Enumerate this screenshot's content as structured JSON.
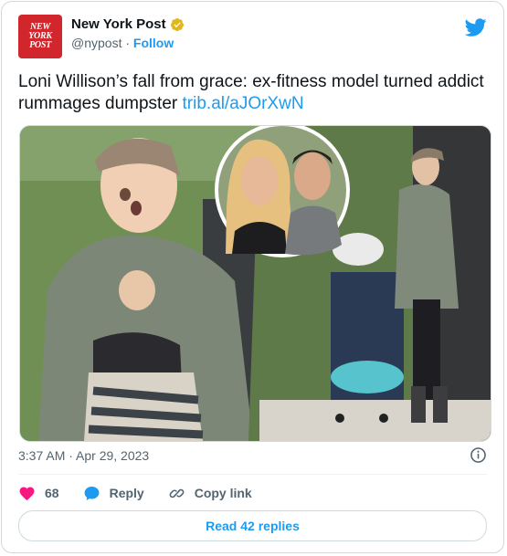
{
  "account": {
    "display_name": "New York Post",
    "handle": "@nypost",
    "separator": "·",
    "follow_label": "Follow",
    "logo_lines": [
      "NEW",
      "YORK",
      "POST"
    ],
    "verified_icon": "verified-badge-icon",
    "logo_icon": "twitter-bird-icon"
  },
  "tweet": {
    "text": "Loni Willison’s fall from grace: ex-fitness model turned addict rummages dumpster ",
    "link": "trib.al/aJOrXwN",
    "timestamp": "3:37 AM · Apr 29, 2023"
  },
  "actions": {
    "likes": "68",
    "reply_label": "Reply",
    "copy_label": "Copy link"
  },
  "read_replies": "Read 42 replies",
  "colors": {
    "accent": "#1d9bf0",
    "like": "#f91880",
    "brand": "#d1262c"
  }
}
